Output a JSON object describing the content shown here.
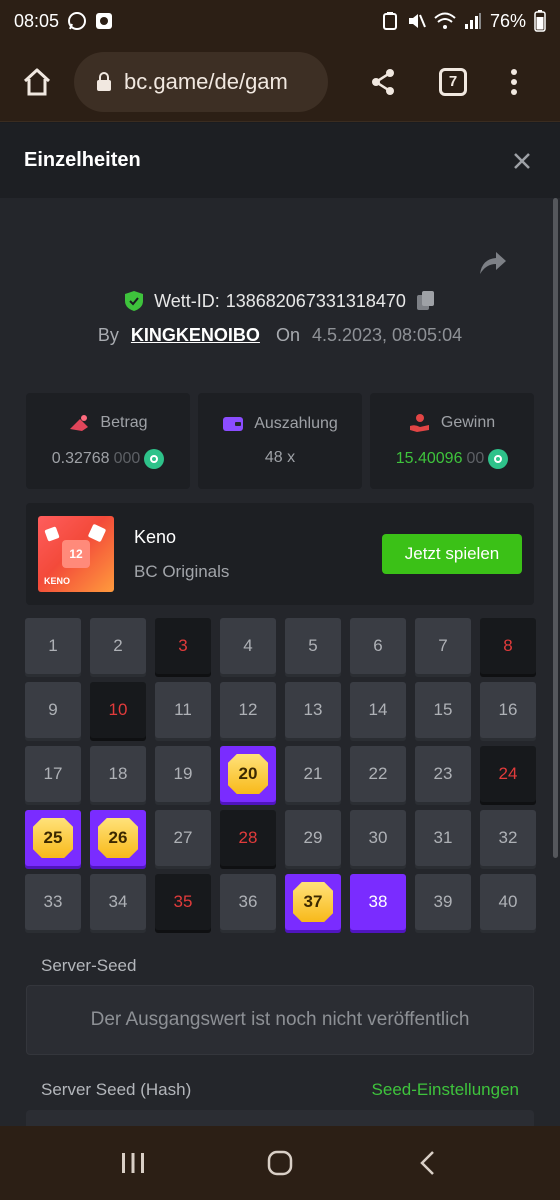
{
  "status_bar": {
    "time": "08:05",
    "battery": "76%"
  },
  "browser": {
    "url": "bc.game/de/gam",
    "tab_count": "7"
  },
  "modal": {
    "title": "Einzelheiten"
  },
  "bet": {
    "id_label": "Wett-ID:",
    "id_value": "138682067331318470",
    "by_label": "By",
    "user": "KINGKENOIBO",
    "on_label": "On",
    "date": "4.5.2023, 08:05:04"
  },
  "stats": {
    "amount_label": "Betrag",
    "amount_value": "0.32768",
    "amount_dim": "000",
    "payout_label": "Auszahlung",
    "payout_value": "48 x",
    "profit_label": "Gewinn",
    "profit_value": "15.40096",
    "profit_dim": "00"
  },
  "game": {
    "name": "Keno",
    "provider": "BC Originals",
    "play_label": "Jetzt spielen",
    "thumb_number": "12",
    "thumb_text": "KENO"
  },
  "keno": {
    "cells": [
      {
        "n": "1",
        "s": "normal"
      },
      {
        "n": "2",
        "s": "normal"
      },
      {
        "n": "3",
        "s": "miss"
      },
      {
        "n": "4",
        "s": "normal"
      },
      {
        "n": "5",
        "s": "normal"
      },
      {
        "n": "6",
        "s": "normal"
      },
      {
        "n": "7",
        "s": "normal"
      },
      {
        "n": "8",
        "s": "miss"
      },
      {
        "n": "9",
        "s": "normal"
      },
      {
        "n": "10",
        "s": "miss"
      },
      {
        "n": "11",
        "s": "normal"
      },
      {
        "n": "12",
        "s": "normal"
      },
      {
        "n": "13",
        "s": "normal"
      },
      {
        "n": "14",
        "s": "normal"
      },
      {
        "n": "15",
        "s": "normal"
      },
      {
        "n": "16",
        "s": "normal"
      },
      {
        "n": "17",
        "s": "normal"
      },
      {
        "n": "18",
        "s": "normal"
      },
      {
        "n": "19",
        "s": "normal"
      },
      {
        "n": "20",
        "s": "hit"
      },
      {
        "n": "21",
        "s": "normal"
      },
      {
        "n": "22",
        "s": "normal"
      },
      {
        "n": "23",
        "s": "normal"
      },
      {
        "n": "24",
        "s": "miss"
      },
      {
        "n": "25",
        "s": "hit"
      },
      {
        "n": "26",
        "s": "hit"
      },
      {
        "n": "27",
        "s": "normal"
      },
      {
        "n": "28",
        "s": "miss"
      },
      {
        "n": "29",
        "s": "normal"
      },
      {
        "n": "30",
        "s": "normal"
      },
      {
        "n": "31",
        "s": "normal"
      },
      {
        "n": "32",
        "s": "normal"
      },
      {
        "n": "33",
        "s": "normal"
      },
      {
        "n": "34",
        "s": "normal"
      },
      {
        "n": "35",
        "s": "miss"
      },
      {
        "n": "36",
        "s": "normal"
      },
      {
        "n": "37",
        "s": "hit"
      },
      {
        "n": "38",
        "s": "pick"
      },
      {
        "n": "39",
        "s": "normal"
      },
      {
        "n": "40",
        "s": "normal"
      }
    ]
  },
  "seeds": {
    "server_seed_label": "Server-Seed",
    "server_seed_value": "Der Ausgangswert ist noch nicht veröffentlich",
    "hash_label": "Server Seed (Hash)",
    "settings_link": "Seed-Einstellungen"
  },
  "colors": {
    "accent_green": "#3bc117",
    "pick_purple": "#7a2cff",
    "miss_red": "#e13b3b"
  }
}
